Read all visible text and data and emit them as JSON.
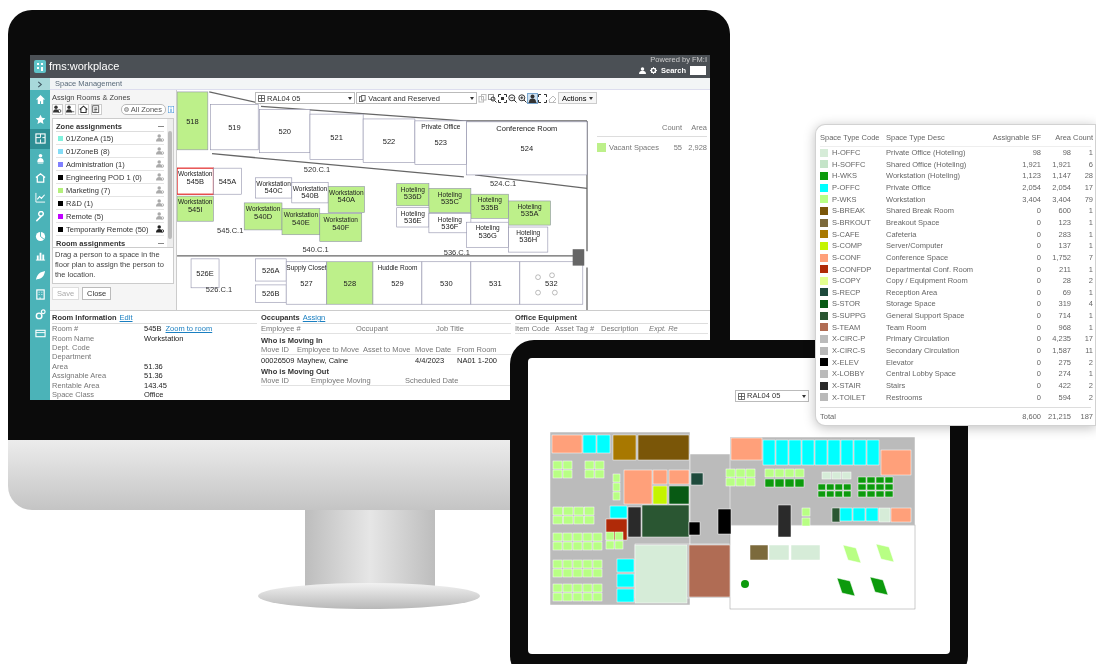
{
  "app": {
    "logo": "fms:workplace",
    "powered_by": "Powered by FM:I",
    "search_label": "Search"
  },
  "sidebar": {
    "items": [
      {
        "selected": false
      },
      {
        "selected": false
      },
      {
        "selected": true
      },
      {
        "selected": false
      },
      {
        "selected": false
      },
      {
        "selected": false
      },
      {
        "selected": false
      },
      {
        "selected": false
      },
      {
        "selected": false
      },
      {
        "selected": false
      },
      {
        "selected": false
      },
      {
        "selected": false
      },
      {
        "selected": false
      }
    ]
  },
  "header": {
    "title": "Space Management"
  },
  "assign_panel": {
    "title": "Assign Rooms & Zones",
    "toggle": {
      "label": "All Zones",
      "on": false
    },
    "zone_heading": "Zone assignments",
    "zones": [
      {
        "name": "01/ZoneA (15)",
        "color": "#80f2de",
        "active": false
      },
      {
        "name": "01/ZoneB (8)",
        "color": "#84dcf6",
        "active": false
      },
      {
        "name": "Administration (1)",
        "color": "#8080ff",
        "active": false
      },
      {
        "name": "Engineering POD 1 (0)",
        "color": "#000000",
        "active": false
      },
      {
        "name": "Marketing (7)",
        "color": "#b4f07c",
        "active": false
      },
      {
        "name": "R&D (1)",
        "color": "#000000",
        "active": false
      },
      {
        "name": "Remote (5)",
        "color": "#c000ff",
        "active": false
      },
      {
        "name": "Temporarily Remote (50)",
        "color": "#000000",
        "active": true
      }
    ],
    "room_heading": "Room assignments",
    "help": "Drag a person to a space in the floor plan to assign the person to the location.",
    "buttons": [
      {
        "label": "Save",
        "disabled": true
      },
      {
        "label": "Close",
        "disabled": false
      }
    ]
  },
  "map": {
    "toolbar": {
      "location": "RAL04 05",
      "filter": "Vacant and Reserved",
      "actions": "Actions",
      "tools": [
        {
          "disabled": true,
          "selected": false
        },
        {
          "disabled": false,
          "selected": false
        },
        {
          "disabled": false,
          "selected": false
        },
        {
          "disabled": false,
          "selected": false
        },
        {
          "disabled": false,
          "selected": false
        },
        {
          "disabled": false,
          "selected": true
        },
        {
          "disabled": false,
          "selected": false
        },
        {
          "disabled": true,
          "selected": false
        }
      ]
    },
    "rooms": [
      {
        "label": "518",
        "vacant": true,
        "selected": false
      },
      {
        "label": "519",
        "vacant": false,
        "selected": false
      },
      {
        "label": "520",
        "vacant": false,
        "selected": false
      },
      {
        "label": "521",
        "vacant": false,
        "selected": false
      },
      {
        "label": "522",
        "vacant": false,
        "selected": false
      },
      {
        "label": "523",
        "tag": "Private Office",
        "vacant": false,
        "selected": false
      },
      {
        "label": "524",
        "tag": "Conference Room",
        "vacant": false,
        "selected": false
      },
      {
        "label": "545B",
        "tag": "Workstation",
        "vacant": false,
        "selected": true
      },
      {
        "label": "545A",
        "vacant": false,
        "selected": false
      },
      {
        "label": "545I",
        "tag": "Workstation",
        "vacant": true,
        "selected": false
      },
      {
        "label": "540C",
        "tag": "Workstation",
        "vacant": false,
        "selected": false
      },
      {
        "label": "540B",
        "tag": "Workstation",
        "vacant": false,
        "selected": false
      },
      {
        "label": "540A",
        "tag": "Workstation",
        "vacant": true,
        "selected": false
      },
      {
        "label": "540D",
        "tag": "Workstation",
        "vacant": true,
        "selected": false
      },
      {
        "label": "540E",
        "tag": "Workstation",
        "vacant": true,
        "selected": false
      },
      {
        "label": "540F",
        "tag": "Workstation",
        "vacant": true,
        "selected": false
      },
      {
        "label": "536D",
        "tag": "Hoteling",
        "vacant": true,
        "selected": false
      },
      {
        "label": "535C",
        "tag": "Hoteling",
        "vacant": true,
        "selected": false
      },
      {
        "label": "535B",
        "tag": "Hoteling",
        "vacant": true,
        "selected": false
      },
      {
        "label": "535A",
        "tag": "Hoteling",
        "vacant": true,
        "selected": false
      },
      {
        "label": "536E",
        "tag": "Hoteling",
        "vacant": false,
        "selected": false
      },
      {
        "label": "536F",
        "tag": "Hoteling",
        "vacant": false,
        "selected": false
      },
      {
        "label": "536G",
        "tag": "Hoteling",
        "vacant": false,
        "selected": false
      },
      {
        "label": "536H",
        "tag": "Hoteling",
        "vacant": false,
        "selected": false
      },
      {
        "label": "526E",
        "vacant": false,
        "selected": false
      },
      {
        "label": "526A",
        "vacant": false,
        "selected": false
      },
      {
        "label": "526B",
        "vacant": false,
        "selected": false
      },
      {
        "label": "527",
        "tag": "Supply Closet",
        "vacant": false,
        "selected": false
      },
      {
        "label": "528",
        "vacant": true,
        "selected": false
      },
      {
        "label": "529",
        "tag": "Huddle Room",
        "vacant": false,
        "selected": false
      },
      {
        "label": "530",
        "vacant": false,
        "selected": false
      },
      {
        "label": "531",
        "vacant": false,
        "selected": false
      },
      {
        "label": "532",
        "vacant": false,
        "selected": false
      }
    ],
    "corridors": [
      "520.C.1",
      "524.C.1",
      "545.C.1",
      "540.C.1",
      "536.C.1",
      "526.C.1"
    ]
  },
  "legend": {
    "columns": [
      "Count",
      "Area"
    ],
    "rows": [
      {
        "label": "Vacant Spaces",
        "color": "#bdf08a",
        "count": "55",
        "area": "2,928"
      }
    ]
  },
  "room_info": {
    "title": "Room Information",
    "action": "Edit",
    "fields": [
      {
        "label": "Room #",
        "value": "545B",
        "link": "Zoom to room"
      },
      {
        "label": "Room Name",
        "value": "Workstation"
      },
      {
        "label": "Dept. Code"
      },
      {
        "label": "Department"
      },
      {
        "label": "Area",
        "value": "51.36"
      },
      {
        "label": "Assignable Area",
        "value": "51.36"
      },
      {
        "label": "Rentable Area",
        "value": "143.45"
      },
      {
        "label": "Space Class",
        "value": "Office"
      }
    ]
  },
  "occupants": {
    "title": "Occupants",
    "action": "Assign",
    "columns": [
      "Employee #",
      "Occupant",
      "Job Title"
    ]
  },
  "moving_in": {
    "title": "Who is Moving In",
    "columns": [
      "Move ID",
      "Employee to Move",
      "Asset to Move",
      "Move Date",
      "From Room"
    ],
    "rows": [
      {
        "move_id": "00026509",
        "employee": "Mayhew, Caine",
        "move_date": "4/4/2023",
        "from_room": "NA01 1-200"
      }
    ]
  },
  "moving_out": {
    "title": "Who is Moving Out",
    "columns": [
      "Move ID",
      "Employee Moving",
      "Scheduled Date"
    ]
  },
  "equipment": {
    "title": "Office Equipment",
    "columns": [
      "Item Code",
      "Asset Tag #",
      "Description",
      "Expt. Re"
    ]
  },
  "tablet": {
    "location": "RAL04 05"
  },
  "space_types": {
    "columns": [
      "Space Type Code",
      "Space Type Desc",
      "Assignable SF",
      "Area",
      "Count"
    ],
    "rows": [
      {
        "code": "H-OFFC",
        "desc": "Private Office (Hoteling)",
        "assignable": "98",
        "area": "98",
        "count": "1",
        "color": "#d6ecd8"
      },
      {
        "code": "H-SOFFC",
        "desc": "Shared Office (Hoteling)",
        "assignable": "1,921",
        "area": "1,921",
        "count": "6",
        "color": "#c4e4c8"
      },
      {
        "code": "H-WKS",
        "desc": "Workstation (Hoteling)",
        "assignable": "1,123",
        "area": "1,147",
        "count": "28",
        "color": "#0c9a0c"
      },
      {
        "code": "P-OFFC",
        "desc": "Private Office",
        "assignable": "2,054",
        "area": "2,054",
        "count": "17",
        "color": "#00ffff"
      },
      {
        "code": "P-WKS",
        "desc": "Workstation",
        "assignable": "3,404",
        "area": "3,404",
        "count": "79",
        "color": "#b8ff84"
      },
      {
        "code": "S-BREAK",
        "desc": "Shared Break Room",
        "assignable": "0",
        "area": "600",
        "count": "1",
        "color": "#7a5608"
      },
      {
        "code": "S-BRKOUT",
        "desc": "Breakout Space",
        "assignable": "0",
        "area": "123",
        "count": "1",
        "color": "#7c6a3c"
      },
      {
        "code": "S-CAFE",
        "desc": "Cafeteria",
        "assignable": "0",
        "area": "283",
        "count": "1",
        "color": "#a87800"
      },
      {
        "code": "S-COMP",
        "desc": "Server/Computer",
        "assignable": "0",
        "area": "137",
        "count": "1",
        "color": "#c4f400"
      },
      {
        "code": "S-CONF",
        "desc": "Conference Space",
        "assignable": "0",
        "area": "1,752",
        "count": "7",
        "color": "#ffa07a"
      },
      {
        "code": "S-CONFDP",
        "desc": "Departmental Conf. Room",
        "assignable": "0",
        "area": "211",
        "count": "1",
        "color": "#b02a08"
      },
      {
        "code": "S-COPY",
        "desc": "Copy / Equipment Room",
        "assignable": "0",
        "area": "28",
        "count": "2",
        "color": "#e4ff90"
      },
      {
        "code": "S-RECP",
        "desc": "Reception Area",
        "assignable": "0",
        "area": "69",
        "count": "1",
        "color": "#1e4a3c"
      },
      {
        "code": "S-STOR",
        "desc": "Storage Space",
        "assignable": "0",
        "area": "319",
        "count": "4",
        "color": "#085a14"
      },
      {
        "code": "S-SUPPG",
        "desc": "General Support Space",
        "assignable": "0",
        "area": "714",
        "count": "1",
        "color": "#2a5632"
      },
      {
        "code": "S-TEAM",
        "desc": "Team Room",
        "assignable": "0",
        "area": "968",
        "count": "1",
        "color": "#b06c54"
      },
      {
        "code": "X-CIRC-P",
        "desc": "Primary Circulation",
        "assignable": "0",
        "area": "4,235",
        "count": "17",
        "color": "#bbbbbb"
      },
      {
        "code": "X-CIRC-S",
        "desc": "Secondary Circulation",
        "assignable": "0",
        "area": "1,587",
        "count": "11",
        "color": "#b8b8b8"
      },
      {
        "code": "X-ELEV",
        "desc": "Elevator",
        "assignable": "0",
        "area": "275",
        "count": "2",
        "color": "#000000"
      },
      {
        "code": "X-LOBBY",
        "desc": "Central Lobby Space",
        "assignable": "0",
        "area": "274",
        "count": "1",
        "color": "#bababa"
      },
      {
        "code": "X-STAIR",
        "desc": "Stairs",
        "assignable": "0",
        "area": "422",
        "count": "2",
        "color": "#2a2a2a"
      },
      {
        "code": "X-TOILET",
        "desc": "Restrooms",
        "assignable": "0",
        "area": "594",
        "count": "2",
        "color": "#b9b9b9"
      }
    ],
    "total": {
      "label": "Total",
      "assignable": "8,600",
      "area": "21,215",
      "count": "187"
    }
  }
}
